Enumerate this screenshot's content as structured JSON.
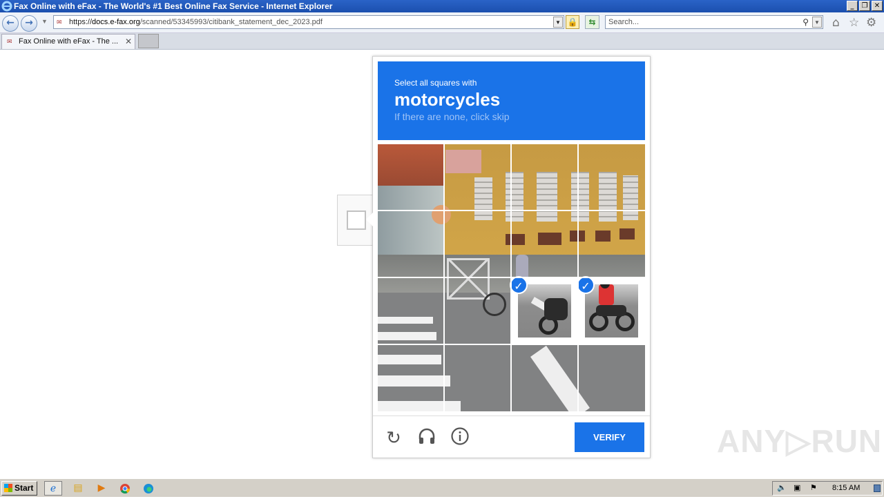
{
  "window": {
    "title": "Fax Online with eFax - The World's #1 Best Online Fax Service - Internet Explorer",
    "minimize": "_",
    "restore": "❐",
    "close": "✕"
  },
  "nav": {
    "back": "←",
    "forward": "→",
    "address_prefix": "https://",
    "address_domain": "docs.e-fax.org",
    "address_path": "/scanned/53345993/citibank_statement_dec_2023.pdf",
    "search_placeholder": "Search...",
    "icons": [
      "back-icon",
      "forward-icon",
      "lock-icon",
      "refresh-icon",
      "search-icon",
      "home-icon",
      "favorites-icon",
      "settings-icon"
    ]
  },
  "tabs": [
    {
      "label": "Fax Online with eFax - The ..."
    }
  ],
  "captcha": {
    "instruction": "Select all squares with",
    "target": "motorcycles",
    "hint": "If there are none, click skip",
    "verify_label": "VERIFY",
    "selected_tiles": [
      6,
      7
    ],
    "grid_size": 4,
    "accent": "#1a73e8"
  },
  "watermark": "ANY▷RUN",
  "taskbar": {
    "start_label": "Start",
    "clock": "8:15 AM",
    "apps": [
      "ie-icon",
      "explorer-icon",
      "media-player-icon",
      "chrome-icon",
      "edge-icon"
    ]
  }
}
